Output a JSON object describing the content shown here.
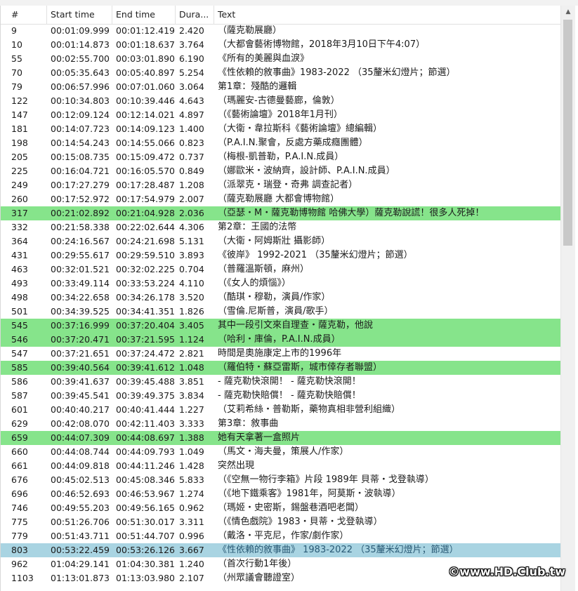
{
  "top_strip": {
    "fragments": [
      "",
      "",
      "",
      ""
    ]
  },
  "header": {
    "columns": [
      "#",
      "Start time",
      "End time",
      "Dura...",
      "Text"
    ]
  },
  "colors": {
    "highlight": "#86e48b",
    "selected": "#a9d4e2",
    "scrollbar_thumb": "#c8c8c8"
  },
  "rows": [
    {
      "num": "9",
      "start": "00:01:09.999",
      "end": "00:01:12.419",
      "dur": "2.420",
      "text": "（薩克勒展廳）",
      "state": ""
    },
    {
      "num": "10",
      "start": "00:01:14.873",
      "end": "00:01:18.637",
      "dur": "3.764",
      "text": "（大都會藝術博物館，2018年3月10日下午4:07）",
      "state": ""
    },
    {
      "num": "55",
      "start": "00:02:55.700",
      "end": "00:03:01.890",
      "dur": "6.190",
      "text": "《所有的美麗與血淚》",
      "state": ""
    },
    {
      "num": "70",
      "start": "00:05:35.643",
      "end": "00:05:40.897",
      "dur": "5.254",
      "text": "《性依賴的敘事曲》1983-2022 （35釐米幻燈片；節選）",
      "state": ""
    },
    {
      "num": "79",
      "start": "00:06:57.996",
      "end": "00:07:01.060",
      "dur": "3.064",
      "text": "第1章：殘酷的邏輯",
      "state": ""
    },
    {
      "num": "122",
      "start": "00:10:34.803",
      "end": "00:10:39.446",
      "dur": "4.643",
      "text": "（瑪麗安-古德曼藝廊，倫敦）",
      "state": ""
    },
    {
      "num": "147",
      "start": "00:12:09.124",
      "end": "00:12:14.021",
      "dur": "4.897",
      "text": "（《藝術論壇》2018年1月刊）",
      "state": ""
    },
    {
      "num": "181",
      "start": "00:14:07.723",
      "end": "00:14:09.123",
      "dur": "1.400",
      "text": "（大衛・韋拉斯科《藝術論壇》總編輯）",
      "state": ""
    },
    {
      "num": "198",
      "start": "00:14:54.243",
      "end": "00:14:55.066",
      "dur": "0.823",
      "text": "（P.A.I.N.聚會，反處方藥成癮團體）",
      "state": ""
    },
    {
      "num": "205",
      "start": "00:15:08.735",
      "end": "00:15:09.472",
      "dur": "0.737",
      "text": "（梅根-凱普勒，P.A.I.N.成員）",
      "state": ""
    },
    {
      "num": "225",
      "start": "00:16:04.721",
      "end": "00:16:05.570",
      "dur": "0.849",
      "text": "（娜歐米・波納齊，設計師、P.A.I.N.成員）",
      "state": ""
    },
    {
      "num": "249",
      "start": "00:17:27.279",
      "end": "00:17:28.487",
      "dur": "1.208",
      "text": "（派翠克・瑞登・奇弗 調查記者）",
      "state": ""
    },
    {
      "num": "260",
      "start": "00:17:52.972",
      "end": "00:17:54.979",
      "dur": "2.007",
      "text": "（薩克勒展廳 大都會博物館）",
      "state": ""
    },
    {
      "num": "317",
      "start": "00:21:02.892",
      "end": "00:21:04.928",
      "dur": "2.036",
      "text": "（亞瑟・M・薩克勒博物館 哈佛大學）薩克勒說謊！很多人死掉！",
      "state": "hl"
    },
    {
      "num": "332",
      "start": "00:21:58.338",
      "end": "00:22:02.644",
      "dur": "4.306",
      "text": "第2章：王國的法幣",
      "state": ""
    },
    {
      "num": "364",
      "start": "00:24:16.567",
      "end": "00:24:21.698",
      "dur": "5.131",
      "text": "（大衛・阿姆斯壯 攝影師）",
      "state": ""
    },
    {
      "num": "431",
      "start": "00:29:55.617",
      "end": "00:29:59.510",
      "dur": "3.893",
      "text": "《彼岸》 1992-2021 （35釐米幻燈片；節選）",
      "state": ""
    },
    {
      "num": "463",
      "start": "00:32:01.521",
      "end": "00:32:02.225",
      "dur": "0.704",
      "text": "（普羅溫斯頓，麻州）",
      "state": ""
    },
    {
      "num": "493",
      "start": "00:33:49.114",
      "end": "00:33:53.224",
      "dur": "4.110",
      "text": "（《女人的煩惱》）",
      "state": ""
    },
    {
      "num": "498",
      "start": "00:34:22.658",
      "end": "00:34:26.178",
      "dur": "3.520",
      "text": "（酷琪・穆勒，演員/作家）",
      "state": ""
    },
    {
      "num": "501",
      "start": "00:34:39.525",
      "end": "00:34:41.351",
      "dur": "1.826",
      "text": "（雪倫.尼斯普，演員/歌手）",
      "state": ""
    },
    {
      "num": "545",
      "start": "00:37:16.999",
      "end": "00:37:20.404",
      "dur": "3.405",
      "text": "其中一段引文來自理查・薩克勒，他說",
      "state": "hl"
    },
    {
      "num": "546",
      "start": "00:37:20.471",
      "end": "00:37:21.595",
      "dur": "1.124",
      "text": "（哈利・庫倫，P.A.I.N.成員）",
      "state": "hl"
    },
    {
      "num": "547",
      "start": "00:37:21.651",
      "end": "00:37:24.472",
      "dur": "2.821",
      "text": "時間是奧施康定上市的1996年",
      "state": ""
    },
    {
      "num": "585",
      "start": "00:39:40.564",
      "end": "00:39:41.612",
      "dur": "1.048",
      "text": "（羅伯特・蘇亞雷斯，城市倖存者聯盟）",
      "state": "hl"
    },
    {
      "num": "586",
      "start": "00:39:41.637",
      "end": "00:39:45.488",
      "dur": "3.851",
      "text": "- 薩克勒快滾開！ - 薩克勒快滾開！",
      "state": ""
    },
    {
      "num": "587",
      "start": "00:39:45.541",
      "end": "00:39:49.375",
      "dur": "3.834",
      "text": "- 薩克勒快賠償！ - 薩克勒快賠償！",
      "state": ""
    },
    {
      "num": "601",
      "start": "00:40:40.217",
      "end": "00:40:41.444",
      "dur": "1.227",
      "text": "（艾莉希絲・普勒斯，藥物真相非營利組織）",
      "state": ""
    },
    {
      "num": "629",
      "start": "00:42:08.070",
      "end": "00:42:11.403",
      "dur": "3.333",
      "text": "第3章：敘事曲",
      "state": ""
    },
    {
      "num": "659",
      "start": "00:44:07.309",
      "end": "00:44:08.697",
      "dur": "1.388",
      "text": "她有天拿著一盒照片",
      "state": "hl"
    },
    {
      "num": "660",
      "start": "00:44:08.744",
      "end": "00:44:09.793",
      "dur": "1.049",
      "text": "（馬文・海夫曼，策展人/作家）",
      "state": ""
    },
    {
      "num": "661",
      "start": "00:44:09.818",
      "end": "00:44:11.246",
      "dur": "1.428",
      "text": "突然出現",
      "state": ""
    },
    {
      "num": "676",
      "start": "00:45:02.513",
      "end": "00:45:08.346",
      "dur": "5.833",
      "text": "（《空無一物行李箱》片段 1989年 貝蒂・戈登執導）",
      "state": ""
    },
    {
      "num": "696",
      "start": "00:46:52.693",
      "end": "00:46:53.967",
      "dur": "1.274",
      "text": "（《地下鐵乘客》1981年，阿莫斯・波執導）",
      "state": ""
    },
    {
      "num": "746",
      "start": "00:49:55.203",
      "end": "00:49:56.165",
      "dur": "0.962",
      "text": "（瑪姬・史密斯，錫盤巷酒吧老闆）",
      "state": ""
    },
    {
      "num": "775",
      "start": "00:51:26.706",
      "end": "00:51:30.017",
      "dur": "3.311",
      "text": "（《情色戲院》1983・貝蒂・戈登執導）",
      "state": ""
    },
    {
      "num": "779",
      "start": "00:51:43.711",
      "end": "00:51:44.707",
      "dur": "0.996",
      "text": "（戴洛・平克尼，作家/劇作家）",
      "state": ""
    },
    {
      "num": "803",
      "start": "00:53:22.459",
      "end": "00:53:26.126",
      "dur": "3.667",
      "text": "《性依賴的敘事曲》 1983-2022 （35釐米幻燈片；節選）",
      "state": "sel"
    },
    {
      "num": "962",
      "start": "01:04:29.141",
      "end": "01:04:30.381",
      "dur": "1.240",
      "text": "（首次行動1年後）",
      "state": ""
    },
    {
      "num": "1103",
      "start": "01:13:01.873",
      "end": "01:13:03.980",
      "dur": "2.107",
      "text": "（州眾議會聽證室）",
      "state": ""
    }
  ],
  "watermark": "©www.HD.Club.tw",
  "scrollbar": {
    "up_icon": "▲"
  }
}
